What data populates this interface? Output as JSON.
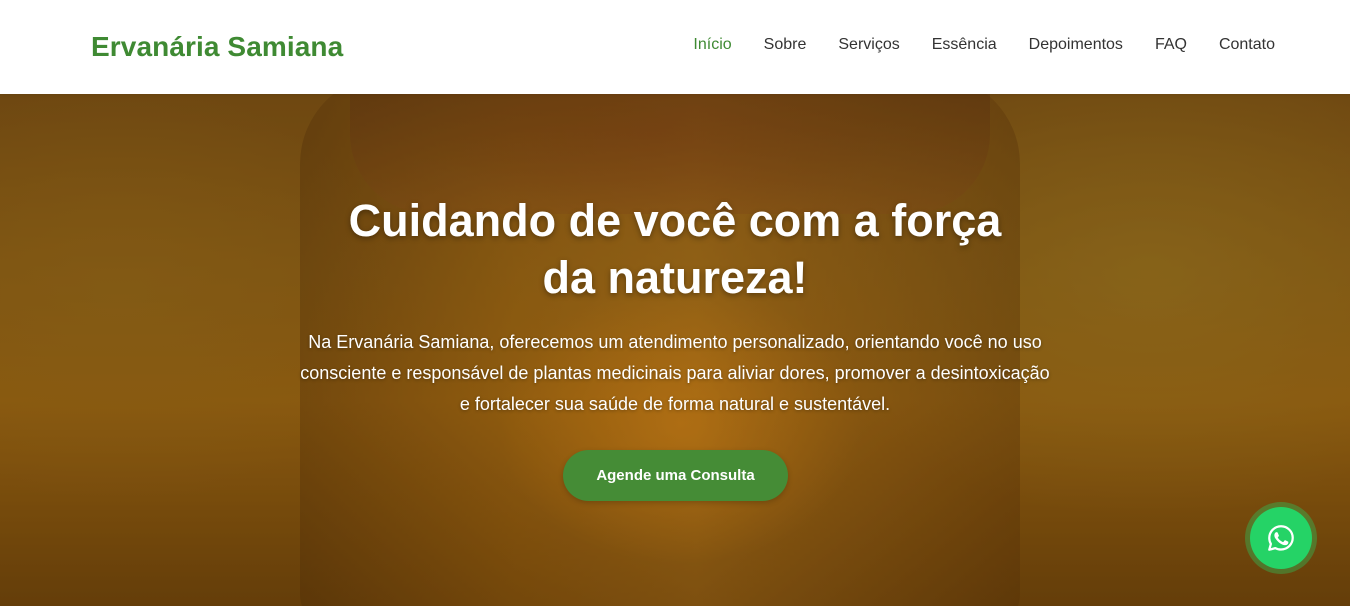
{
  "brand": {
    "name": "Ervanária Samiana"
  },
  "nav": {
    "items": [
      {
        "label": "Início",
        "active": true
      },
      {
        "label": "Sobre",
        "active": false
      },
      {
        "label": "Serviços",
        "active": false
      },
      {
        "label": "Essência",
        "active": false
      },
      {
        "label": "Depoimentos",
        "active": false
      },
      {
        "label": "FAQ",
        "active": false
      },
      {
        "label": "Contato",
        "active": false
      }
    ]
  },
  "hero": {
    "headline_line1": "Cuidando de você com a força",
    "headline_line2": "da natureza!",
    "lead": "Na Ervanária Samiana, oferecemos um atendimento personalizado, orientando você no uso consciente e responsável de plantas medicinais para aliviar dores, promover a desintoxicação e fortalecer sua saúde de forma natural e sustentável.",
    "cta_label": "Agende uma Consulta"
  },
  "floating": {
    "icon": "whatsapp-icon"
  },
  "colors": {
    "brand_green": "#3f8a33",
    "cta_green": "#458c36",
    "whatsapp_green": "#25d366"
  }
}
